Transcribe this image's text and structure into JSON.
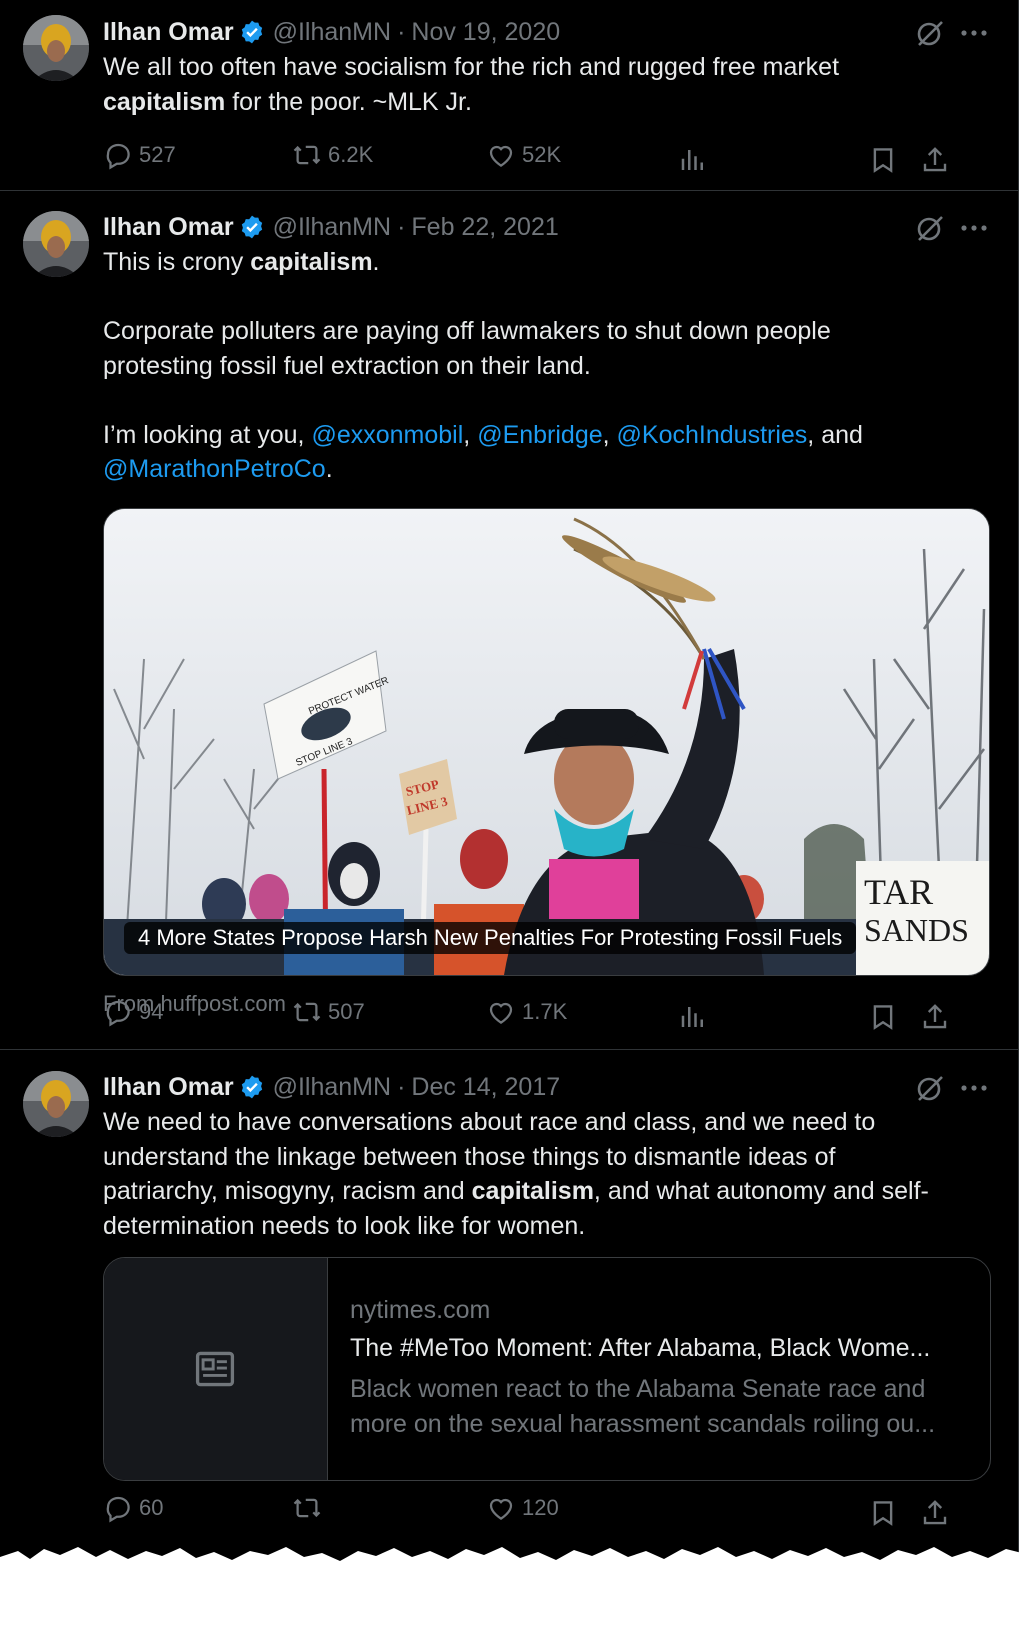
{
  "colors": {
    "background": "#000000",
    "text": "#e7e9ea",
    "muted": "#71767b",
    "link": "#1d9bf0",
    "verified": "#1d9bf0",
    "divider": "#2f3336"
  },
  "tweets": [
    {
      "author": {
        "name": "Ilhan Omar",
        "handle": "@IlhanMN",
        "verified": true
      },
      "dot": "·",
      "date": "Nov 19, 2020",
      "text": {
        "p1_a": "We all too often have socialism for the rich and rugged free market",
        "p1_b": "capitalism",
        "p1_c": " for the poor. ~MLK Jr."
      },
      "stats": {
        "replies": "527",
        "reposts": "6.2K",
        "likes": "52K"
      }
    },
    {
      "author": {
        "name": "Ilhan Omar",
        "handle": "@IlhanMN",
        "verified": true
      },
      "dot": "·",
      "date": "Feb 22, 2021",
      "text": {
        "p1_a": "This is crony ",
        "p1_b": "capitalism",
        "p1_c": ".",
        "p2_l1": "Corporate polluters are paying off lawmakers to shut down people",
        "p2_l2": "protesting fossil fuel extraction on their land.",
        "p3_a": "I’m looking at you, ",
        "m1": "@exxonmobil",
        "sep1": ", ",
        "m2": "@Enbridge",
        "sep2": ", ",
        "m3": "@KochIndustries",
        "sep3": ", and",
        "m4": "@MarathonPetroCo",
        "end": "."
      },
      "media": {
        "caption": "4 More States Propose Harsh New Penalties For Protesting Fossil Fuels",
        "source": "From huffpost.com",
        "sign1_top": "PROTECT WATER",
        "sign1_bottom": "STOP LINE 3",
        "sign2_l1": "STOP",
        "sign2_l2": "LINE 3",
        "sign3_l1": "TAR",
        "sign3_l2": "SANDS"
      },
      "stats": {
        "replies": "94",
        "reposts": "507",
        "likes": "1.7K"
      }
    },
    {
      "author": {
        "name": "Ilhan Omar",
        "handle": "@IlhanMN",
        "verified": true
      },
      "dot": "·",
      "date": "Dec 14, 2017",
      "text": {
        "l1": "We need to have conversations about race and class, and we need to",
        "l2": "understand the linkage between those things to dismantle ideas of",
        "l3_a": "patriarchy, misogyny, racism and ",
        "l3_b": "capitalism",
        "l3_c": ", and what autonomy and self-",
        "l4": "determination needs to look like for women."
      },
      "card": {
        "domain": "nytimes.com",
        "title": "The #MeToo Moment: After Alabama, Black Wome...",
        "desc_l1": "Black women react to the Alabama Senate race and",
        "desc_l2": "more on the sexual harassment scandals roiling ou..."
      },
      "stats": {
        "replies": "60",
        "reposts": "",
        "likes": "120"
      }
    }
  ]
}
